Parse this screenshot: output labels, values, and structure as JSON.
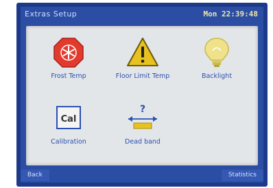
{
  "header": {
    "title": "Extras Setup",
    "clock": "Mon 22:39:48"
  },
  "tiles": [
    {
      "label": "Frost Temp",
      "icon": "snowflake-stop-icon"
    },
    {
      "label": "Floor Limit Temp",
      "icon": "warning-triangle-icon"
    },
    {
      "label": "Backlight",
      "icon": "lightbulb-icon"
    },
    {
      "label": "Calibration",
      "icon": "cal-icon",
      "icon_text": "Cal"
    },
    {
      "label": "Dead band",
      "icon": "deadband-icon",
      "icon_text": "?"
    }
  ],
  "softkeys": {
    "left": "Back",
    "right": "Statistics"
  },
  "colors": {
    "frame": "#1d3a8a",
    "screen": "#2b4ea4",
    "panel": "#e3e6e8",
    "label": "#2a4fb0",
    "clock": "#f0e6a8",
    "warning": "#e8c21e",
    "stop": "#e23b2e",
    "bulb": "#efe28a"
  }
}
